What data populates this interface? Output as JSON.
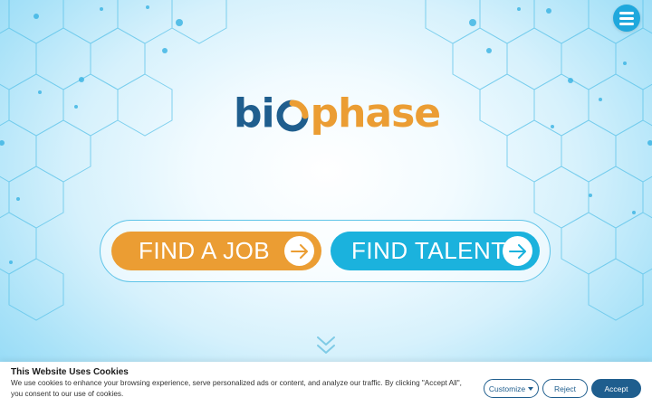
{
  "brand": {
    "logo_prefix": "bi",
    "logo_suffix": "phase",
    "colors": {
      "navy": "#1f5e8e",
      "orange": "#eb9d33",
      "cyan": "#1bb2dd"
    }
  },
  "header": {
    "menu_icon": "hamburger-icon"
  },
  "actions": {
    "find_job_label": "FIND A JOB",
    "find_talent_label": "FIND TALENT",
    "arrow_icon": "arrow-right-icon",
    "scroll_icon": "double-chevron-down-icon"
  },
  "cookie_banner": {
    "title": "This Website Uses Cookies",
    "text": "We use cookies to enhance your browsing experience, serve personalized ads or content, and analyze our traffic. By clicking \"Accept All\", you consent to our use of cookies.",
    "customize_label": "Customize",
    "reject_label": "Reject",
    "accept_label": "Accept"
  }
}
